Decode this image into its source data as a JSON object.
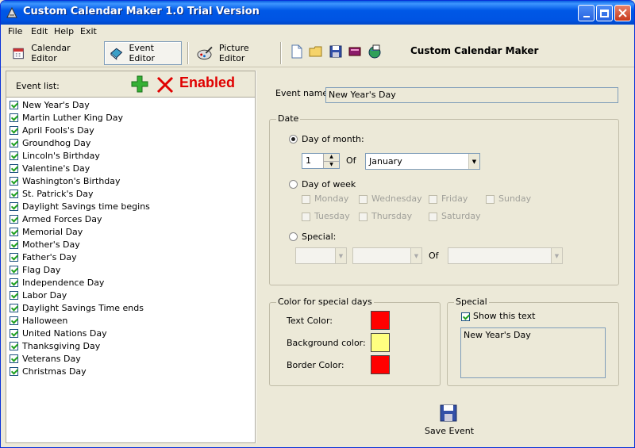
{
  "window": {
    "title": "Custom Calendar Maker 1.0 Trial Version"
  },
  "menu": [
    "File",
    "Edit",
    "Help",
    "Exit"
  ],
  "toolbar": {
    "calendar_editor": "Calendar Editor",
    "event_editor": "Event Editor",
    "picture_editor": "Picture Editor",
    "app_name": "Custom Calendar Maker"
  },
  "events": {
    "list_label": "Event list:",
    "enabled_label": "Enabled",
    "items": [
      "New Year's Day",
      "Martin Luther King Day",
      "April Fools's Day",
      "Groundhog Day",
      "Lincoln's Birthday",
      "Valentine's Day",
      "Washington's Birthday",
      "St. Patrick's Day",
      "Daylight Savings time begins",
      "Armed Forces Day",
      "Memorial Day",
      "Mother's Day",
      "Father's Day",
      "Flag Day",
      "Independence Day",
      "Labor Day",
      "Daylight Savings Time ends",
      "Halloween",
      "United Nations Day",
      "Thanksgiving Day",
      "Veterans Day",
      "Christmas Day"
    ]
  },
  "editor": {
    "event_name_label": "Event name:",
    "event_name_value": "New Year's Day",
    "date_group": "Date",
    "day_of_month_label": "Day of month:",
    "day_value": "1",
    "of_label": "Of",
    "month_value": "January",
    "day_of_week_label": "Day of week",
    "weekdays": [
      "Monday",
      "Wednesday",
      "Friday",
      "Sunday",
      "Tuesday",
      "Thursday",
      "Saturday"
    ],
    "special_label": "Special:",
    "of_label2": "Of"
  },
  "colors": {
    "group": "Color for special days",
    "text_color_label": "Text Color:",
    "bg_color_label": "Background color:",
    "border_color_label": "Border Color:",
    "text_color": "#FF0000",
    "bg_color": "#FFFF80",
    "border_color": "#FF0000"
  },
  "special": {
    "group": "Special",
    "show_text_label": "Show this text",
    "text_value": "New Year's Day"
  },
  "save_label": "Save Event"
}
